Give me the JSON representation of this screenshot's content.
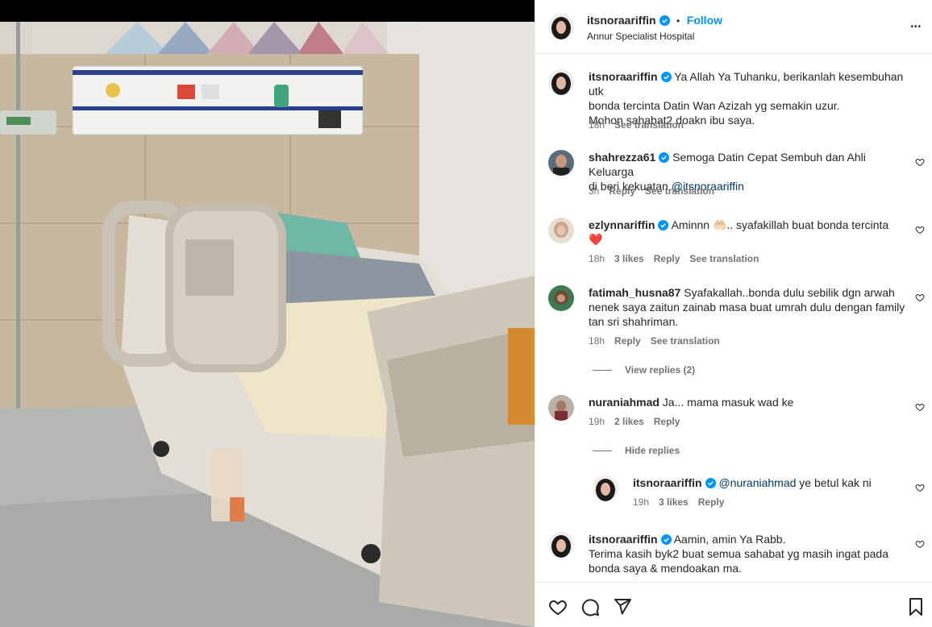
{
  "post": {
    "author": "itsnoraariffin",
    "follow_label": "Follow",
    "separator": "•",
    "location": "Annur Specialist Hospital",
    "more_label": "•••"
  },
  "comments": [
    {
      "user": "itsnoraariffin",
      "verified": true,
      "text_lines": [
        "Ya Allah Ya Tuhanku, berikanlah kesembuhan utk",
        "bonda tercinta Datin Wan Azizah yg semakin uzur.",
        "Mohon sahabat2 doakn ibu saya."
      ],
      "time": "18h",
      "see_translation": "See translation"
    },
    {
      "user": "shahrezza61",
      "verified": true,
      "text_lines": [
        "Semoga Datin Cepat Sembuh dan Ahli Keluarga",
        "di beri kekuatan"
      ],
      "mention": "@itsnoraariffin",
      "time": "3h",
      "reply": "Reply",
      "see_translation": "See translation"
    },
    {
      "user": "ezlynnariffin",
      "verified": true,
      "text_lines": [
        "Aminnn 🤲🏻.. syafakillah buat bonda tercinta",
        "❤️"
      ],
      "time": "18h",
      "likes": "3 likes",
      "reply": "Reply",
      "see_translation": "See translation"
    },
    {
      "user": "fatimah_husna87",
      "verified": false,
      "text_lines": [
        "Syafakallah..bonda dulu sebilik dgn arwah",
        "nenek saya zaitun zainab masa buat umrah dulu dengan family",
        "tan sri shahriman."
      ],
      "time": "18h",
      "reply": "Reply",
      "see_translation": "See translation",
      "view_replies": "View replies (2)"
    },
    {
      "user": "nuraniahmad",
      "verified": false,
      "text_lines": [
        "Ja... mama masuk wad ke"
      ],
      "time": "19h",
      "likes": "2 likes",
      "reply": "Reply",
      "hide_replies": "Hide replies"
    },
    {
      "user": "itsnoraariffin",
      "verified": true,
      "mention": "@nuraniahmad",
      "text_lines": [
        "ye betul kak ni"
      ],
      "time": "19h",
      "likes": "3 likes",
      "reply": "Reply"
    },
    {
      "user": "itsnoraariffin",
      "verified": true,
      "text_lines": [
        "Aamin, amin Ya Rabb.",
        "Terima kasih byk2 buat semua sahabat yg masih ingat pada",
        "bonda saya & mendoakan ma."
      ]
    }
  ],
  "icons": {
    "like": "heart-icon",
    "comment": "comment-icon",
    "share": "share-icon",
    "save": "bookmark-icon"
  },
  "colors": {
    "accent": "#0095f6",
    "verified": "#0095f6",
    "secondary_text": "#737373",
    "mention": "#00376b"
  }
}
